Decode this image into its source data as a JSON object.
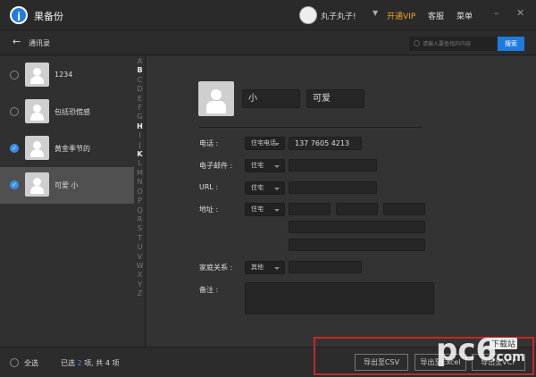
{
  "app": {
    "title": "果备份",
    "user": "丸子丸子!",
    "vip": "开通VIP",
    "service": "客服",
    "menu": "菜单",
    "accent": "#f5a623"
  },
  "subbar": {
    "back_label": "通讯录",
    "search_placeholder": "请输入要查找的内容",
    "search_button": "搜索"
  },
  "contacts": [
    {
      "name": "1234",
      "checked": false
    },
    {
      "name": "包括恐慌感",
      "checked": false
    },
    {
      "name": "黄金季节的",
      "checked": true
    },
    {
      "name": "可爱 小",
      "checked": true,
      "selected": true
    }
  ],
  "index_letters": [
    "A",
    "B",
    "C",
    "D",
    "E",
    "F",
    "G",
    "H",
    "I",
    "J",
    "K",
    "L",
    "M",
    "N",
    "O",
    "P",
    "Q",
    "R",
    "S",
    "T",
    "U",
    "V",
    "W",
    "X",
    "Y",
    "Z"
  ],
  "index_bold": [
    "B",
    "H",
    "K"
  ],
  "detail": {
    "first_name": "小",
    "last_name": "可爱",
    "phone": {
      "label": "电话 :",
      "type": "住宅电话",
      "value": "137 7605 4213"
    },
    "email": {
      "label": "电子邮件 :",
      "type": "住宅",
      "value": ""
    },
    "url": {
      "label": "URL :",
      "type": "住宅",
      "value": ""
    },
    "address": {
      "label": "地址 :",
      "type": "住宅"
    },
    "family": {
      "label": "家庭关系 :",
      "type": "其他",
      "value": ""
    },
    "notes": {
      "label": "备注 :",
      "value": ""
    }
  },
  "footer": {
    "select_all": "全选",
    "selected_prefix": "已选",
    "selected_count": "2",
    "selected_mid": "项, 共",
    "total": "4",
    "selected_suffix": "项",
    "export_csv": "导出至CSV",
    "export_excel": "导出至Excel",
    "export_vcf": "导出至VCF"
  },
  "watermark": {
    "text": "pc6",
    "badge": "下载站",
    "domain": ".com"
  }
}
